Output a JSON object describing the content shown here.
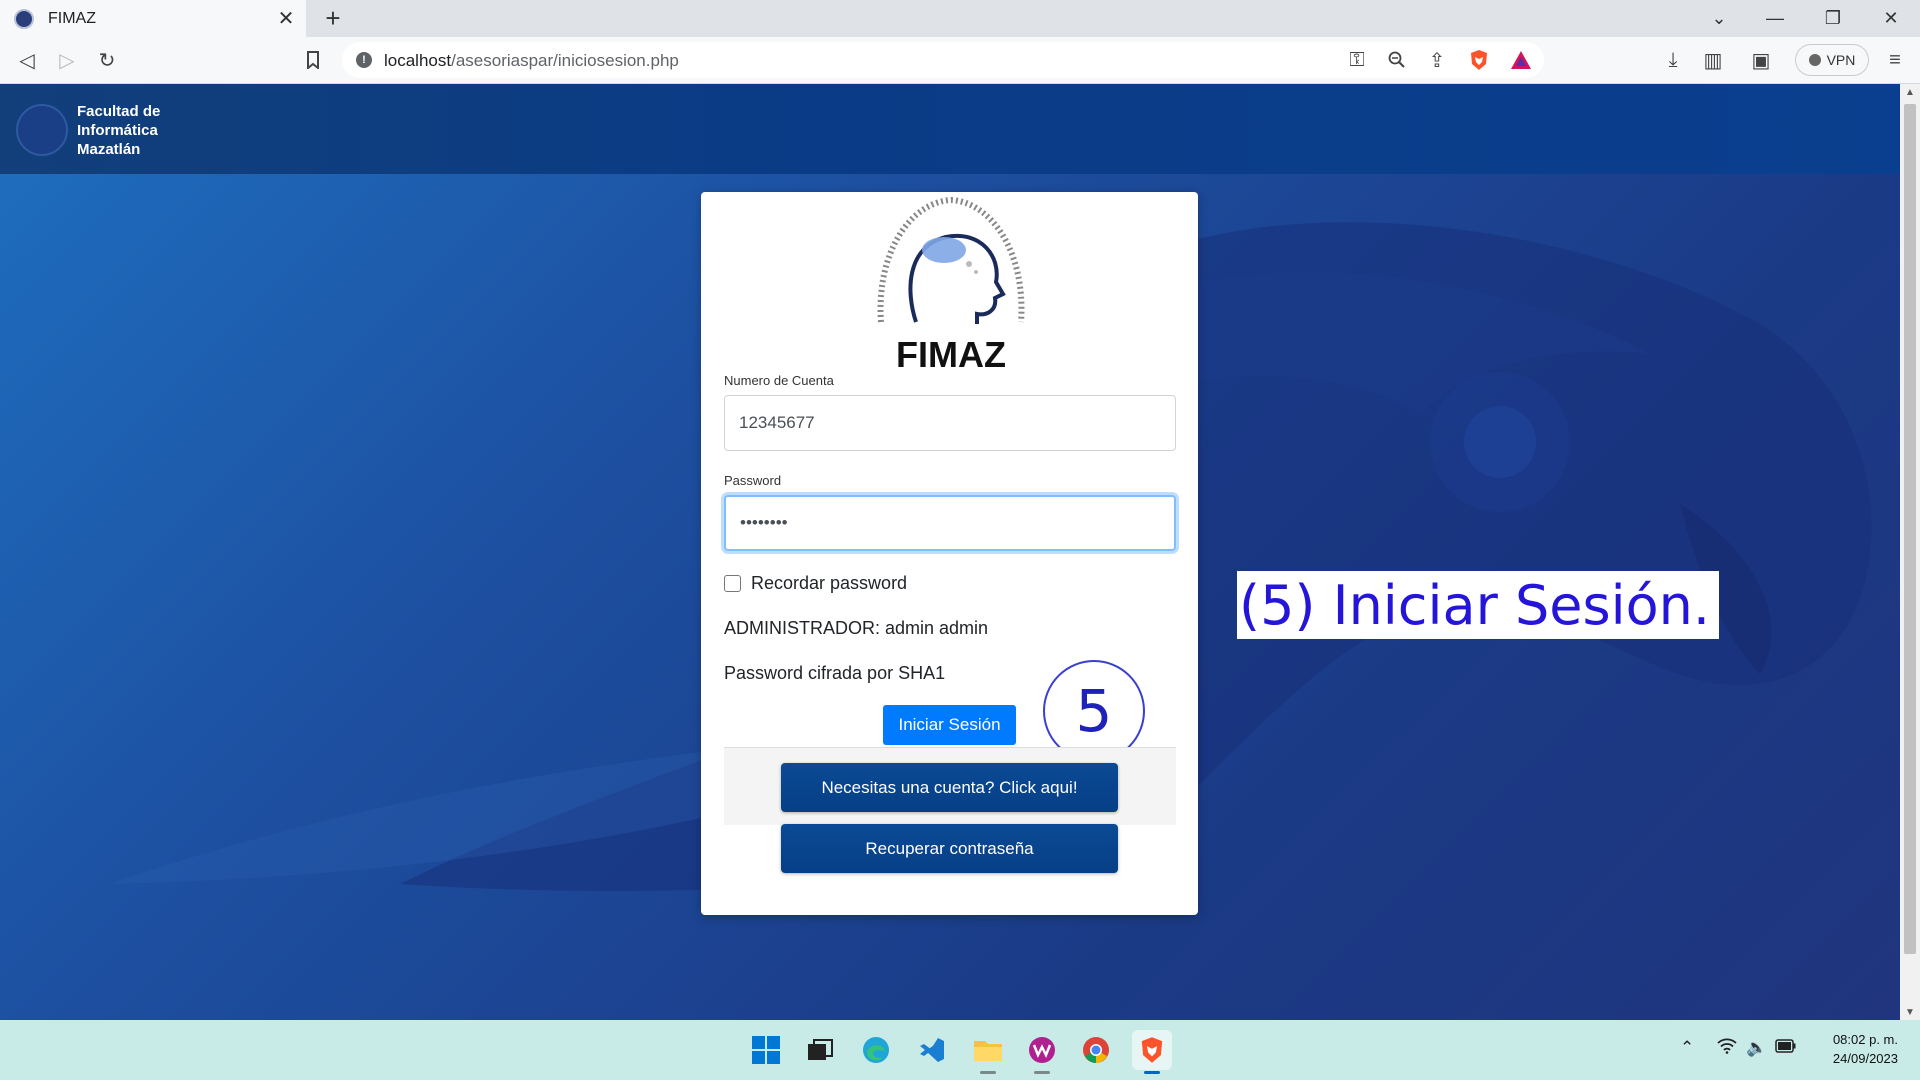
{
  "browser": {
    "tab_title": "FIMAZ",
    "url_host": "localhost",
    "url_path": "/asesoriaspar/iniciosesion.php",
    "vpn_label": "VPN"
  },
  "site": {
    "brand_lines": [
      "Facultad de",
      "Informática",
      "Mazatlán"
    ],
    "logo_caption": "FIMAZ"
  },
  "login": {
    "account_label": "Numero de Cuenta",
    "account_value": "12345677",
    "password_label": "Password",
    "password_value": "••••••••",
    "remember_label": "Recordar password",
    "admin_note": "ADMINISTRADOR: admin admin",
    "sha_note": "Password cifrada por SHA1",
    "submit_label": "Iniciar Sesión",
    "register_label": "Necesitas una cuenta? Click aqui!",
    "recover_label": "Recuperar contraseña"
  },
  "annotations": {
    "step_number": "5",
    "step_caption": "(5) Iniciar Sesión."
  },
  "taskbar": {
    "time": "08:02 p. m.",
    "date": "24/09/2023"
  },
  "colors": {
    "primary_button": "#007bff",
    "dark_button": "#063f86",
    "annotation_text": "#2415d8"
  }
}
